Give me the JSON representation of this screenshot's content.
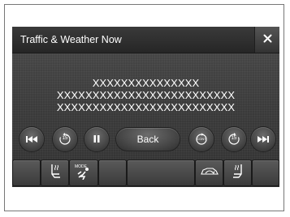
{
  "header": {
    "title": "Traffic & Weather Now",
    "close_glyph": "✕"
  },
  "message": {
    "lines": [
      "XXXXXXXXXXXXXXX",
      "XXXXXXXXXXXXXXXXXXXXXXXXX",
      "XXXXXXXXXXXXXXXXXXXXXXXXX"
    ]
  },
  "controls": {
    "back_label": "Back",
    "skip_back_label": "15",
    "cont_label": "CONT",
    "skip_forward_label": "15"
  },
  "bottom_bar": {
    "mode_label": "MODE"
  },
  "icons": [
    "previous-track-icon",
    "skip-back-15-icon",
    "pause-icon",
    "continuous-icon",
    "skip-forward-15-icon",
    "next-track-icon",
    "seat-heater-icon",
    "climate-mode-icon",
    "recirculation-icon",
    "close-icon"
  ]
}
